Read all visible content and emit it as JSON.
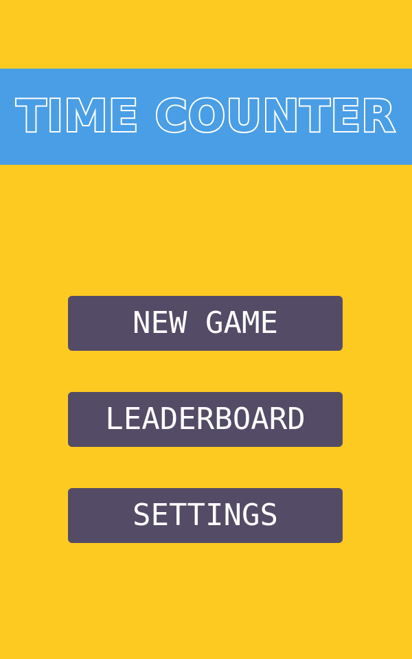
{
  "title": "TIME COUNTER",
  "menu": {
    "new_game_label": "NEW GAME",
    "leaderboard_label": "LEADERBOARD",
    "settings_label": "SETTINGS"
  },
  "colors": {
    "background": "#FDCA22",
    "banner": "#4A9EE5",
    "button": "#544C66",
    "button_text": "#FFFFFF",
    "title_outline": "#FFFFFF"
  }
}
